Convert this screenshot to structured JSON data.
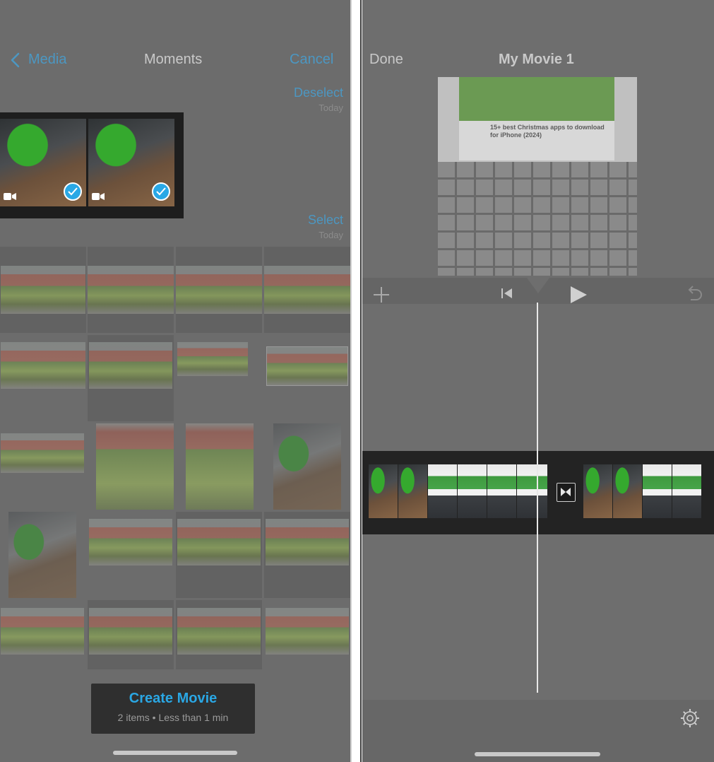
{
  "left_screen": {
    "nav": {
      "back_label": "Media",
      "title": "Moments",
      "cancel_label": "Cancel"
    },
    "section1": {
      "action_label": "Deselect",
      "date_label": "Today"
    },
    "section2": {
      "action_label": "Select",
      "date_label": "Today"
    },
    "selected_count": 2,
    "grid_rows": 5,
    "grid_cols": 4,
    "create_movie": {
      "title": "Create Movie",
      "subtitle": "2 items • Less than 1 min"
    }
  },
  "right_screen": {
    "nav": {
      "done_label": "Done",
      "title": "My Movie 1"
    },
    "preview": {
      "caption": "15+ best Christmas apps to download for iPhone (2024)"
    },
    "icons": [
      "plus-icon",
      "skip-back-icon",
      "play-icon",
      "undo-icon",
      "transition-icon",
      "settings-gear-icon"
    ]
  },
  "colors": {
    "accent_blue": "#2aa7e4",
    "link_blue_dimmed": "#4c97c2",
    "overlay_gray": "#6c6c6c",
    "timeline_bg": "#232323"
  }
}
